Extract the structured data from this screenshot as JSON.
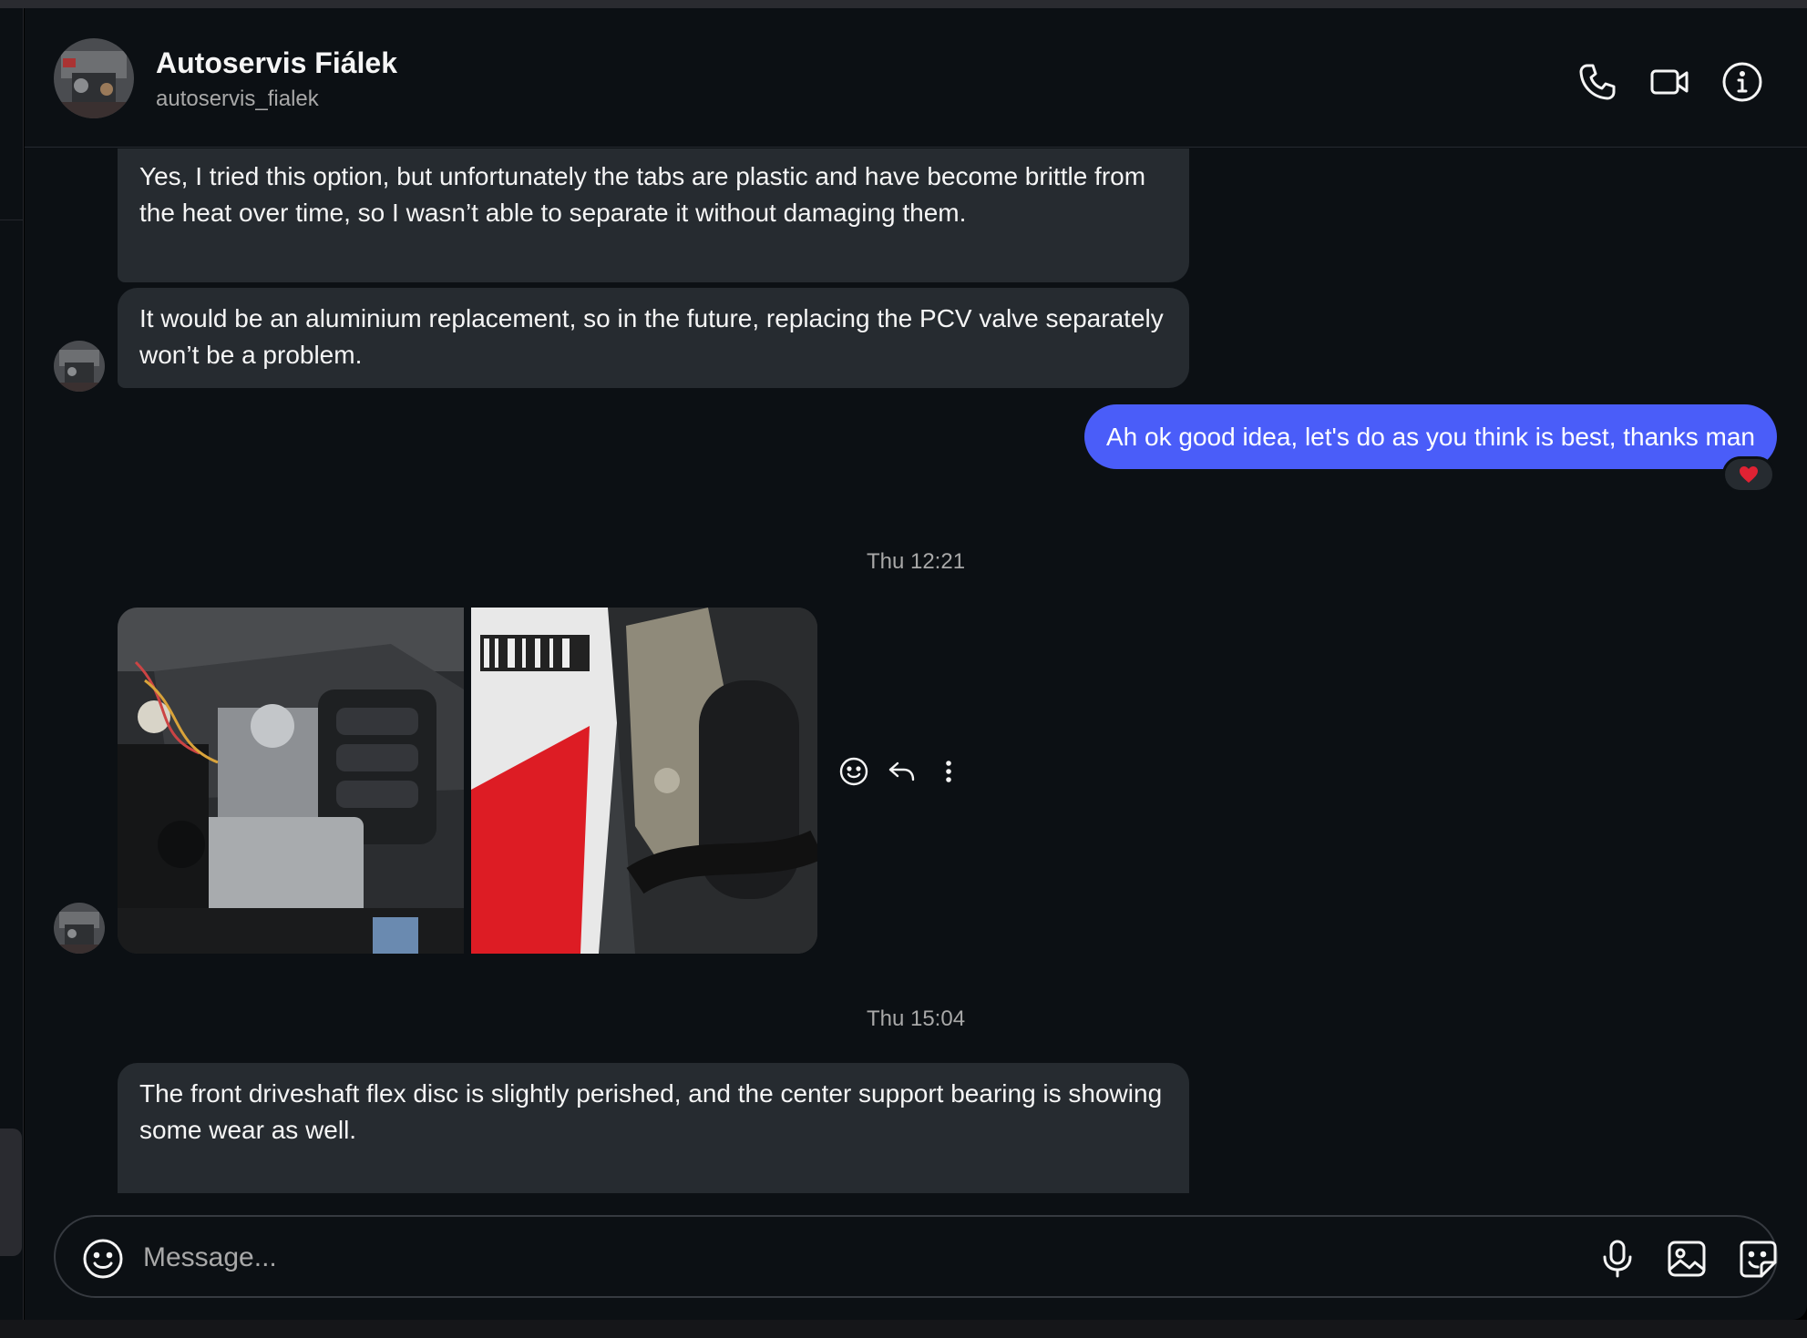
{
  "header": {
    "name": "Autoservis Fiálek",
    "handle": "autoservis_fialek"
  },
  "messages": [
    {
      "direction": "in",
      "text": "Yes, I tried this option, but unfortunately the tabs are plastic and have become brittle from the heat over time, so I wasn’t able to separate it without damaging them."
    },
    {
      "direction": "in",
      "text": "It would be an aluminium replacement, so in the future, replacing the PCV valve separately won’t be a problem."
    },
    {
      "direction": "out",
      "text": "Ah ok good idea, let's do as you think is best, thanks man",
      "reaction": "❤️"
    },
    {
      "direction": "in",
      "text": "The front driveshaft flex disc is slightly perished, and the center support bearing is showing some wear as well."
    }
  ],
  "timestamps": [
    "Thu 12:21",
    "Thu 15:04"
  ],
  "composer": {
    "placeholder": "Message..."
  },
  "icons": {
    "call": "phone-icon",
    "video": "video-camera-icon",
    "info": "info-icon",
    "react": "emoji-icon",
    "reply": "reply-icon",
    "more": "more-vertical-icon",
    "mic": "microphone-icon",
    "image": "image-icon",
    "sticker": "sticker-icon"
  },
  "colors": {
    "background": "#0c1014",
    "incoming_bubble": "#262b30",
    "outgoing_bubble": "#4a5df9",
    "text": "#f5f5f5",
    "muted_text": "#a8a8a8"
  }
}
